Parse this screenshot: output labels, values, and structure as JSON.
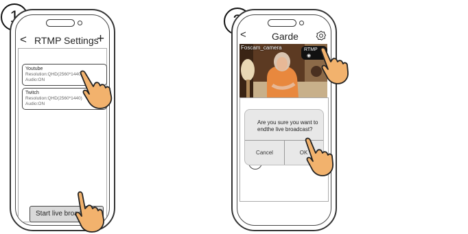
{
  "steps": [
    "1",
    "2"
  ],
  "phone1": {
    "back_glyph": "<",
    "title": "RTMP Settings",
    "add_glyph": "+",
    "streams": [
      {
        "name": "Youtube",
        "resolution": "Resolution:QHD(2560*1440)",
        "audio": "Audio:ON"
      },
      {
        "name": "Twitch",
        "resolution": "Resolution:QHD(2560*1440)",
        "audio": "Audio:ON"
      }
    ],
    "start_button": "Start live broadcast"
  },
  "phone2": {
    "back_glyph": "<",
    "title": "Garde",
    "camera_name": "Foscam_camera",
    "rtmp_badge": "RTMP",
    "dialog": {
      "message_line1": "Are you sure you want to",
      "message_line2": "endthe live broadcast?",
      "cancel": "Cancel",
      "ok": "OK"
    },
    "more_glyph": "•••"
  },
  "icons": {
    "gear": "gear-icon",
    "hand": "pointing-hand-icon",
    "record": "record-circle-icon"
  }
}
